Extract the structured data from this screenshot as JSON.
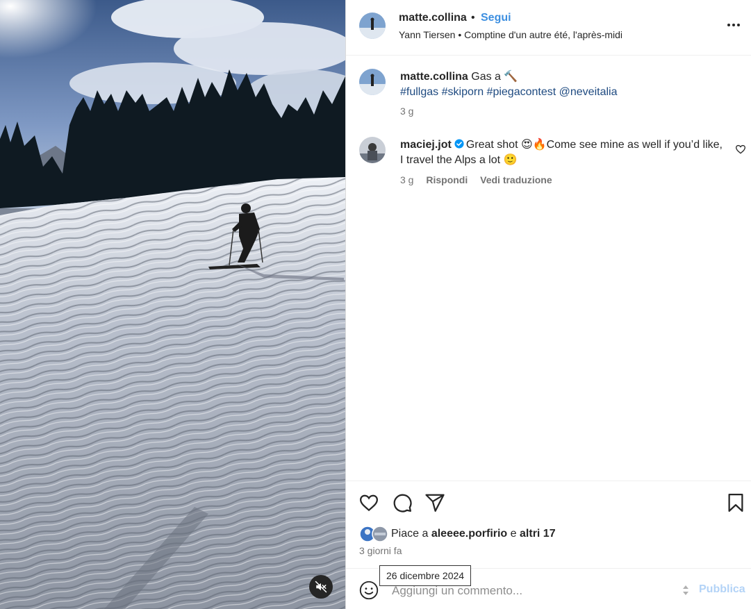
{
  "post": {
    "username": "matte.collina",
    "dot": "•",
    "follow_label": "Segui",
    "audio": "Yann Tiersen • Comptine d'un autre été, l'après-midi",
    "more_icon": "more-horizontal-icon"
  },
  "caption": {
    "username": "matte.collina",
    "text": "Gas a",
    "emoji": "🔨",
    "hashtags": [
      "#fullgas",
      "#skiporn",
      "#piegacontest"
    ],
    "mention": "@neveitalia",
    "time": "3 g"
  },
  "comments": [
    {
      "username": "maciej.jot",
      "verified": true,
      "text_line": "Great shot 😍🔥Come see mine as well if you’d like, I travel the Alps a lot 🙂",
      "time": "3 g",
      "reply_label": "Rispondi",
      "translate_label": "Vedi traduzione"
    }
  ],
  "actions": {
    "like_icon": "heart-icon",
    "comment_icon": "comment-bubble-icon",
    "share_icon": "send-icon",
    "save_icon": "bookmark-icon"
  },
  "likes": {
    "prefix": "Piace a",
    "user": "aleeee.porfirio",
    "conjunction": "e",
    "others": "altri 17"
  },
  "timestamp": "3 giorni fa",
  "tooltip": "26 dicembre 2024",
  "composer": {
    "placeholder": "Aggiungi un commento...",
    "publish_label": "Pubblica"
  },
  "colors": {
    "accent": "#0095f6",
    "follow": "#3d8fe0",
    "hashtag": "#1e4a80",
    "muted": "#737373",
    "publish_disabled": "#b3d3f7"
  }
}
